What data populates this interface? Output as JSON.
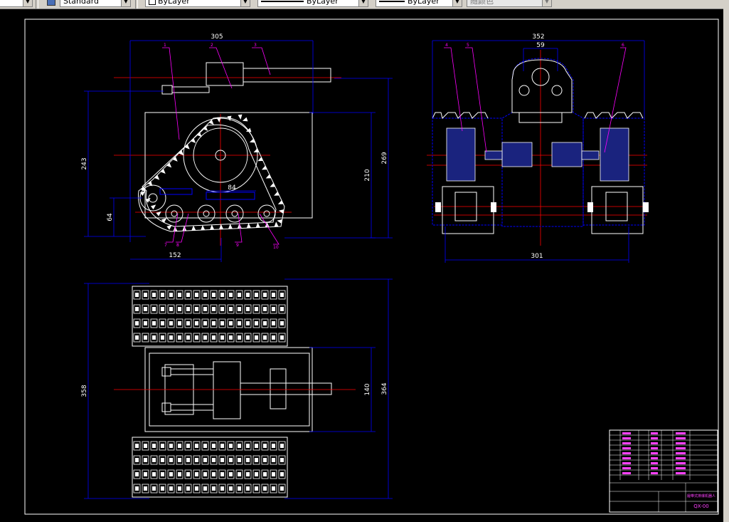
{
  "toolbar": {
    "textstyle_value": "Standard",
    "layer_color_value": "ByLayer",
    "linetype_value": "ByLayer",
    "lineweight_value": "ByLayer",
    "plotstyle_value": "随颜色"
  },
  "colors": {
    "background": "#000000",
    "geometry": "#ffffff",
    "dimension": "#0000ff",
    "centerline": "#ff0000",
    "leader": "#ff00ff",
    "hatch_fill": "#1a237e"
  },
  "drawing": {
    "front_view": {
      "dims": {
        "width_305": "305",
        "height_243": "243",
        "height_210": "210",
        "height_269": "269",
        "height_64": "64",
        "base_152": "152",
        "center_84": "84"
      },
      "balloons": [
        "1",
        "2",
        "3",
        "7",
        "8",
        "9",
        "10"
      ]
    },
    "side_view": {
      "dims": {
        "width_352": "352",
        "width_59": "59",
        "width_301": "301"
      },
      "balloons": [
        "4",
        "5",
        "6"
      ]
    },
    "top_view": {
      "dims": {
        "length_358": "358",
        "width_140": "140",
        "width_364": "364"
      }
    },
    "title_block": {
      "drawing_number": "QX-00",
      "title": "履带式排爆机器人"
    }
  }
}
